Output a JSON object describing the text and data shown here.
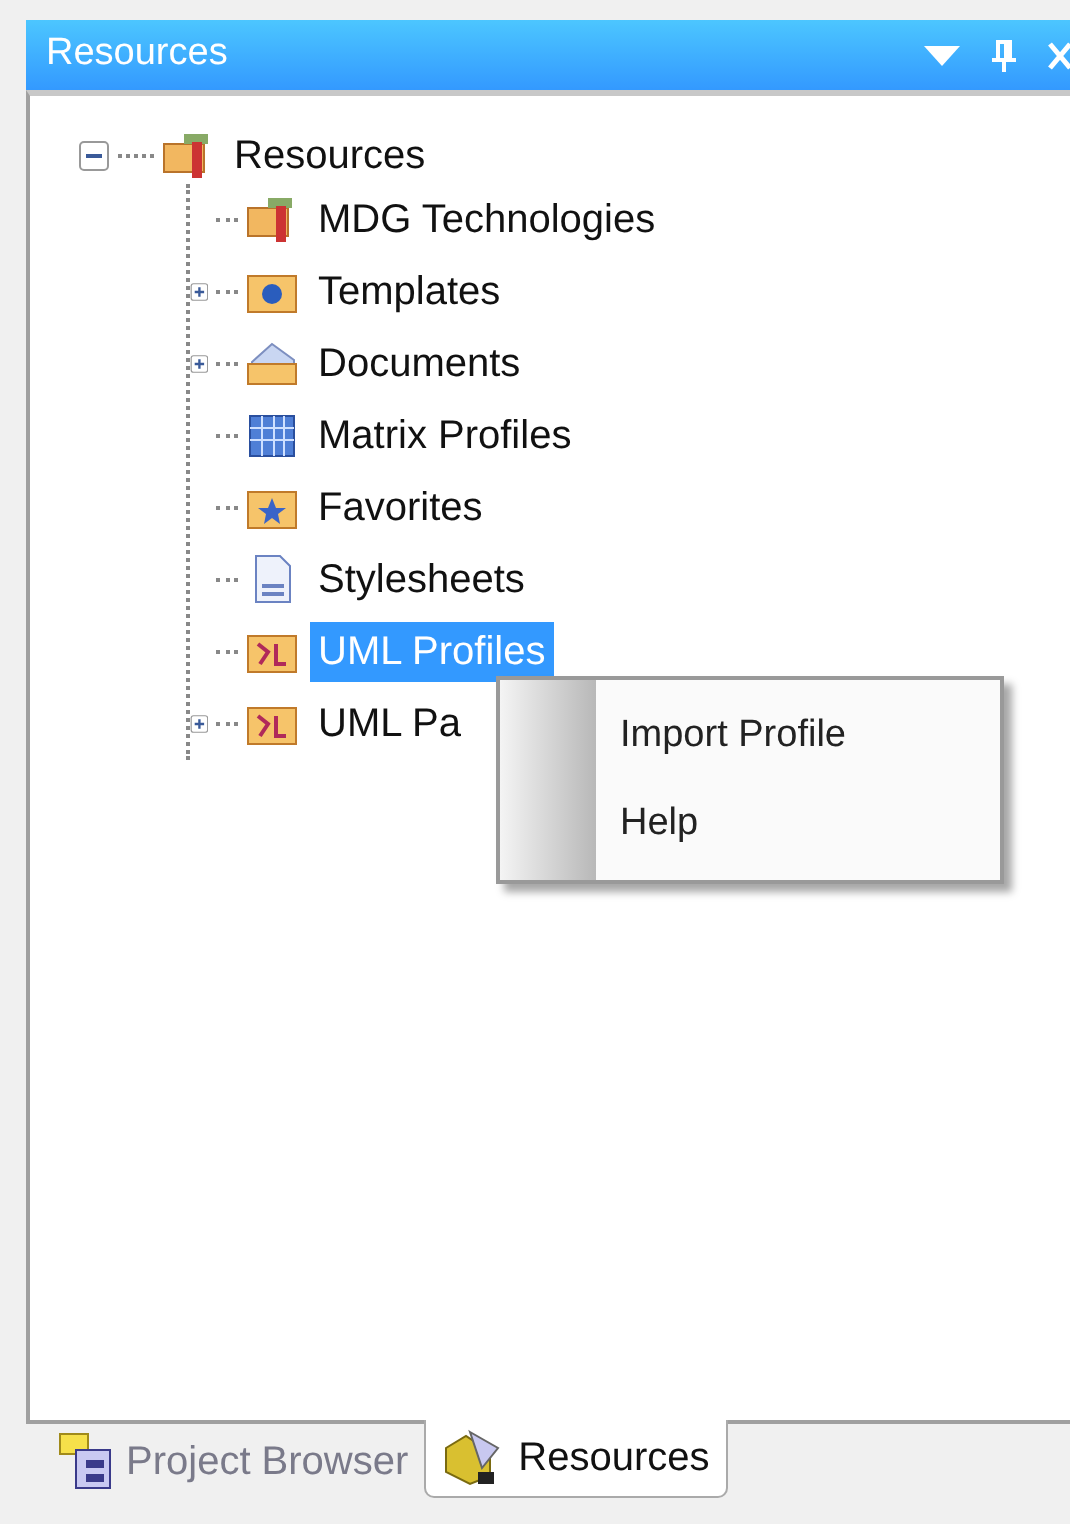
{
  "panel": {
    "title": "Resources"
  },
  "tree": [
    {
      "label": "Resources",
      "kind": "technology",
      "expandable": true,
      "expanded": true,
      "selected": false,
      "children": [
        {
          "label": "MDG Technologies",
          "kind": "technology",
          "expandable": false,
          "selected": false
        },
        {
          "label": "Templates",
          "kind": "info-folder",
          "expandable": true,
          "expanded": false,
          "selected": false
        },
        {
          "label": "Documents",
          "kind": "documents",
          "expandable": true,
          "expanded": false,
          "selected": false
        },
        {
          "label": "Matrix Profiles",
          "kind": "matrix",
          "expandable": false,
          "selected": false
        },
        {
          "label": "Favorites",
          "kind": "favorites",
          "expandable": false,
          "selected": false
        },
        {
          "label": "Stylesheets",
          "kind": "stylesheet",
          "expandable": false,
          "selected": false
        },
        {
          "label": "UML Profiles",
          "kind": "profile",
          "expandable": false,
          "selected": true
        },
        {
          "label": "UML Pa",
          "kind": "profile",
          "expandable": true,
          "expanded": false,
          "selected": false
        }
      ]
    }
  ],
  "context_menu": [
    {
      "label": "Import Profile"
    },
    {
      "label": "Help"
    }
  ],
  "tabs": [
    {
      "label": "Project Browser",
      "kind": "browser",
      "selected": false
    },
    {
      "label": "Resources",
      "kind": "resources",
      "selected": true
    }
  ]
}
